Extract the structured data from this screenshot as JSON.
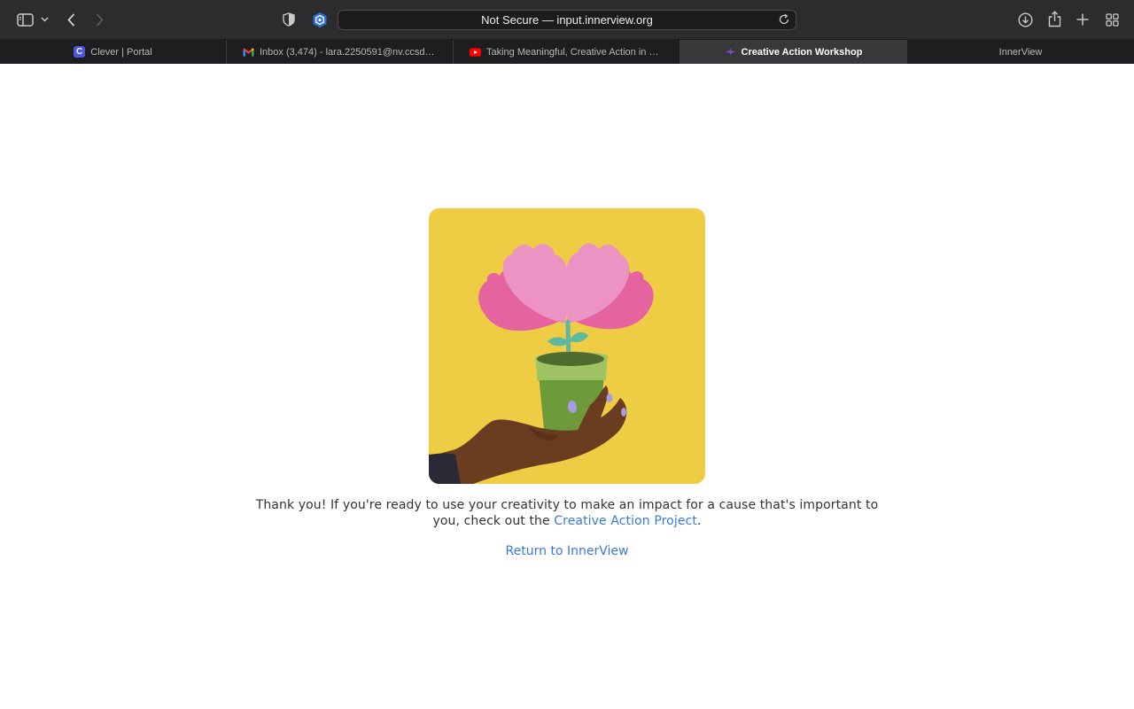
{
  "browser": {
    "address": "Not Secure — input.innerview.org",
    "tabs": [
      {
        "label": "Clever | Portal",
        "icon": "clever-icon",
        "active": false
      },
      {
        "label": "Inbox (3,474) - lara.2250591@nv.ccsd.n...",
        "icon": "gmail-icon",
        "active": false
      },
      {
        "label": "Taking Meaningful, Creative Action in Las...",
        "icon": "youtube-icon",
        "active": false
      },
      {
        "label": "Creative Action Workshop",
        "icon": "sparkle-icon",
        "active": true
      },
      {
        "label": "InnerView",
        "icon": "",
        "active": false
      }
    ]
  },
  "page": {
    "message_before": "Thank you! If you're ready to use your creativity to make an impact for a cause that's important to you, check out the ",
    "project_link": "Creative Action Project",
    "message_after": ".",
    "return_link": "Return to InnerView"
  },
  "colors": {
    "link": "#3a78d6",
    "illustration_bg": "#eecd45",
    "petal_pink": "#e5649f",
    "petal_light": "#ec93c4",
    "pot_green": "#9fc465"
  }
}
